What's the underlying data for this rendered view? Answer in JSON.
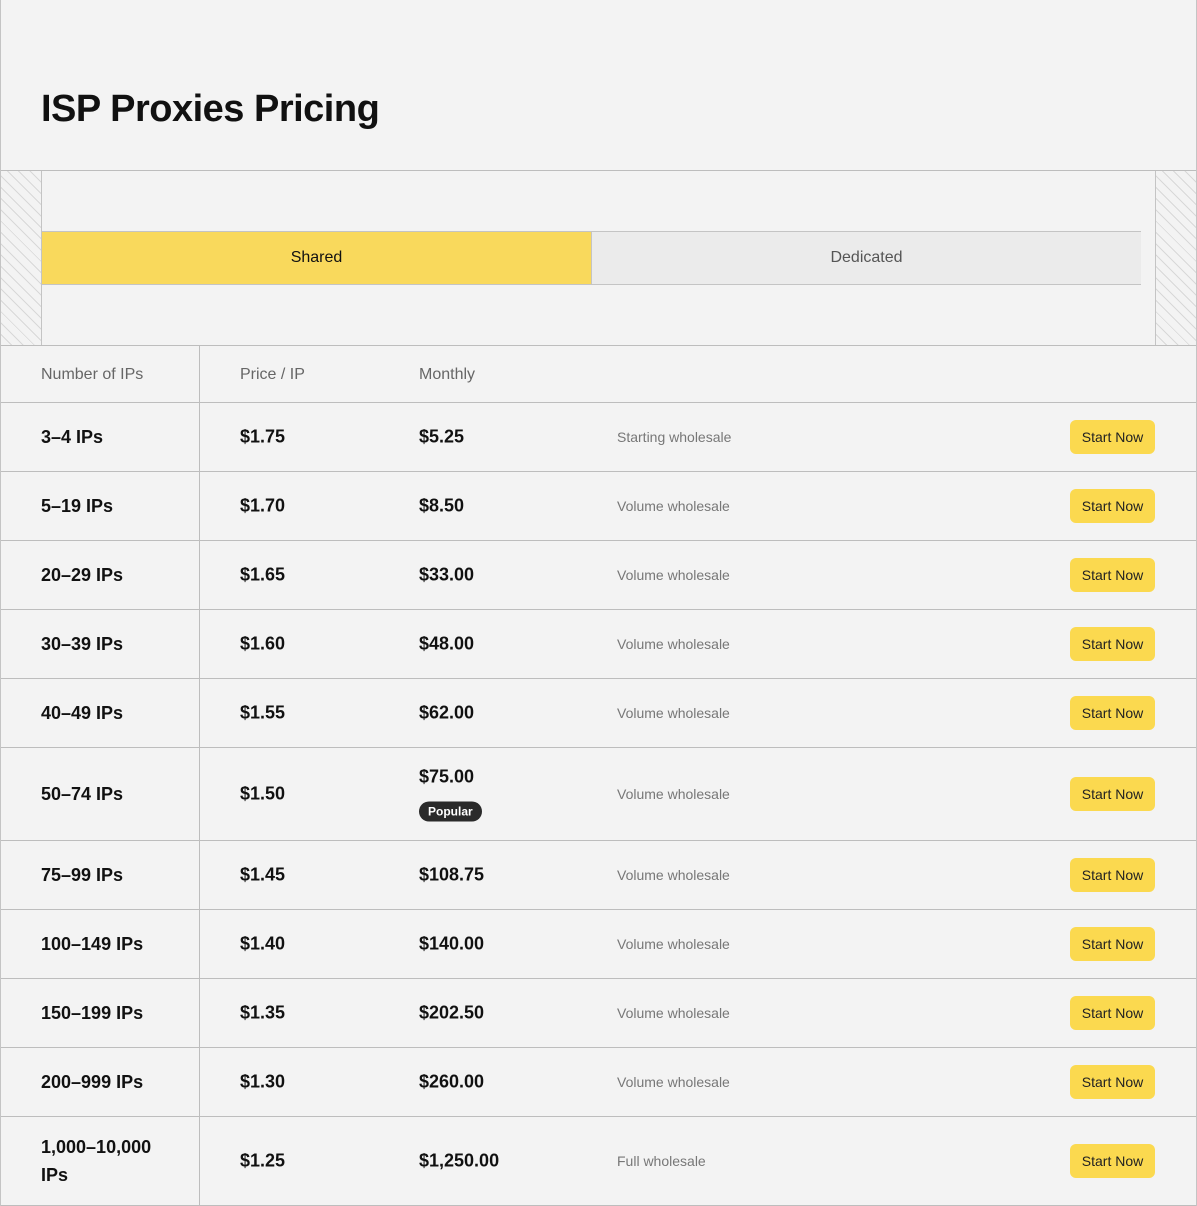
{
  "page": {
    "title": "ISP Proxies Pricing"
  },
  "tabs": [
    {
      "label": "Shared",
      "active": true
    },
    {
      "label": "Dedicated",
      "active": false
    }
  ],
  "table": {
    "headers": {
      "ips": "Number of IPs",
      "price": "Price / IP",
      "monthly": "Monthly"
    },
    "button_label": "Start Now",
    "popular_label": "Popular",
    "rows": [
      {
        "ips": "3–4 IPs",
        "price": "$1.75",
        "monthly": "$5.25",
        "note": "Starting wholesale"
      },
      {
        "ips": "5–19 IPs",
        "price": "$1.70",
        "monthly": "$8.50",
        "note": "Volume wholesale"
      },
      {
        "ips": "20–29 IPs",
        "price": "$1.65",
        "monthly": "$33.00",
        "note": "Volume wholesale"
      },
      {
        "ips": "30–39 IPs",
        "price": "$1.60",
        "monthly": "$48.00",
        "note": "Volume wholesale"
      },
      {
        "ips": "40–49 IPs",
        "price": "$1.55",
        "monthly": "$62.00",
        "note": "Volume wholesale"
      },
      {
        "ips": "50–74 IPs",
        "price": "$1.50",
        "monthly": "$75.00",
        "note": "Volume wholesale",
        "popular": true
      },
      {
        "ips": "75–99 IPs",
        "price": "$1.45",
        "monthly": "$108.75",
        "note": "Volume wholesale"
      },
      {
        "ips": "100–149 IPs",
        "price": "$1.40",
        "monthly": "$140.00",
        "note": "Volume wholesale"
      },
      {
        "ips": "150–199 IPs",
        "price": "$1.35",
        "monthly": "$202.50",
        "note": "Volume wholesale"
      },
      {
        "ips": "200–999 IPs",
        "price": "$1.30",
        "monthly": "$260.00",
        "note": "Volume wholesale"
      },
      {
        "ips": "1,000–10,000 IPs",
        "price": "$1.25",
        "monthly": "$1,250.00",
        "note": "Full wholesale"
      }
    ]
  },
  "colors": {
    "accent": "#f9d95c",
    "button": "#fbd94f",
    "background": "#f3f3f3",
    "badge": "#2a2a2a"
  }
}
